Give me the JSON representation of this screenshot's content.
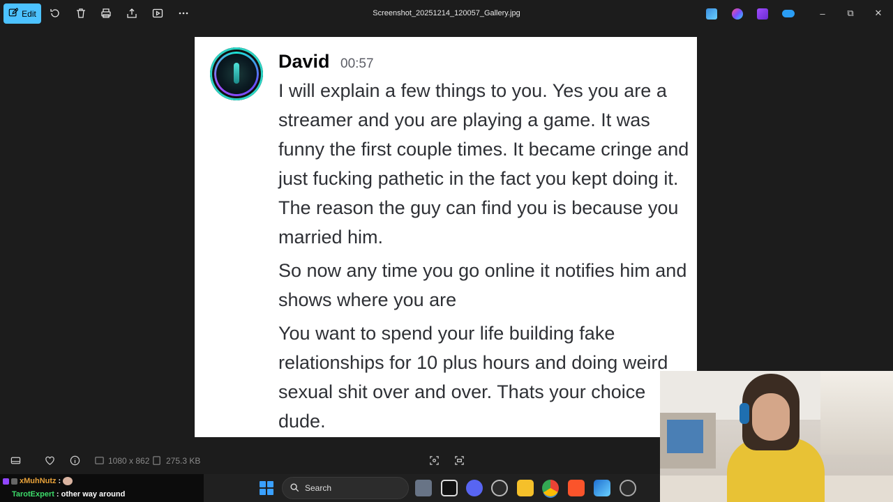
{
  "toolbar": {
    "edit_label": "Edit",
    "file_title": "Screenshot_20251214_120057_Gallery.jpg"
  },
  "message": {
    "author": "David",
    "time": "00:57",
    "paragraphs": [
      "I will explain a few things to you. Yes you are a streamer and you are playing a game. It was funny the first couple times. It became cringe and just fucking pathetic in the fact you kept doing it. The reason the guy can find you is because you married him.",
      "So now any time you go online it notifies him and shows where you are",
      "You want to spend your life building fake relationships for 10 plus hours and doing weird sexual shit over and over. Thats your choice dude."
    ]
  },
  "infobar": {
    "dimensions": "1080 x 862",
    "filesize": "275.3 KB"
  },
  "taskbar": {
    "search_label": "Search"
  },
  "chat": {
    "line1_user": "xMuhNutz",
    "line1_sep": ":",
    "line2_user": "TarotExpert",
    "line2_text": ": other way around"
  },
  "colors": {
    "accent": "#4cc2ff",
    "chat_user1": "#e8a23a",
    "chat_user2": "#3ddc6a"
  }
}
